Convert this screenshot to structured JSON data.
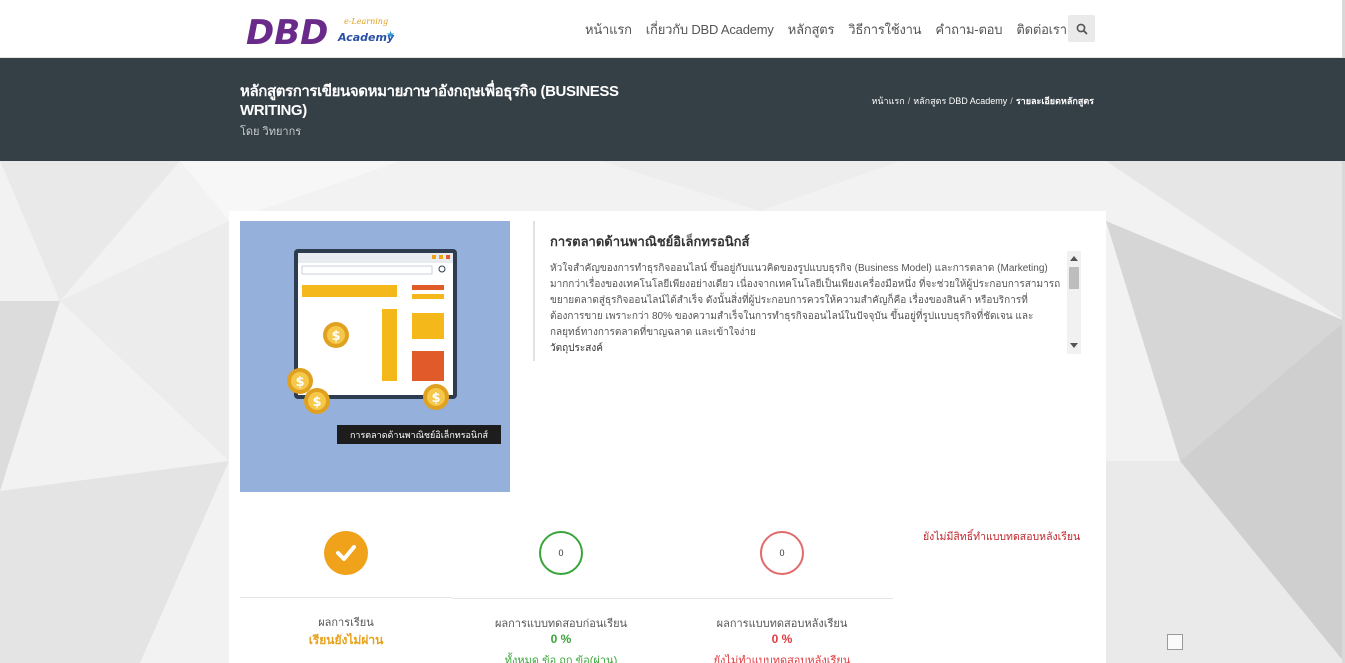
{
  "header": {
    "logo_main": "DBD",
    "logo_sub_top": "e-Learning",
    "logo_sub_bottom": "Academy",
    "nav": [
      "หน้าแรก",
      "เกี่ยวกับ DBD Academy",
      "หลักสูตร",
      "วิธีการใช้งาน",
      "คำถาม-ตอบ",
      "ติดต่อเรา"
    ],
    "search_icon": "search-icon"
  },
  "course": {
    "title": "หลักสูตรการเขียนจดหมายภาษาอังกฤษเพื่อธุรกิจ (BUSINESS WRITING)",
    "by": "โดย วิทยากร",
    "breadcrumb": [
      "หน้าแรก",
      "หลักสูตร DBD Academy",
      "รายละเอียดหลักสูตร"
    ],
    "image_caption": "การตลาดด้านพาณิชย์อิเล็กทรอนิกส์",
    "desc_title": "การตลาดด้านพาณิชย์อิเล็กทรอนิกส์",
    "desc_body": "หัวใจสำคัญของการทำธุรกิจออนไลน์ ขึ้นอยู่กับแนวคิดของรูปแบบธุรกิจ (Business Model) และการตลาด (Marketing) มากกว่าเรื่องของเทคโนโลยีเพียงอย่างเดียว เนื่องจากเทคโนโลยีเป็นเพียงเครื่องมือหนึ่ง ที่จะช่วยให้ผู้ประกอบการสามารถขยายตลาดสู่ธุรกิจออนไลน์ได้สำเร็จ ดังนั้นสิ่งที่ผู้ประกอบการควรให้ความสำคัญก็คือ เรื่องของสินค้า หรือบริการที่ต้องการขาย เพราะกว่า 80% ของความสำเร็จในการทำธุรกิจออนไลน์ในปัจจุบัน ขึ้นอยู่ที่รูปแบบธุรกิจที่ชัดเจน และกลยุทธ์ทางการตลาดที่ขาญฉลาด และเข้าใจง่าย",
    "desc_sub": "วัตถุประสงค์"
  },
  "stats": {
    "learning": {
      "label": "ผลการเรียน",
      "value": "เรียนยังไม่ผ่าน",
      "color": "#e8a21b"
    },
    "pretest": {
      "circle": "0",
      "label": "ผลการแบบทดสอบก่อนเรียน",
      "value": "0 %",
      "sub": "ทั้งหมด ข้อ ถูก ข้อ(ผ่าน)",
      "color": "#3aa53a"
    },
    "posttest": {
      "circle": "0",
      "label": "ผลการแบบทดสอบหลังเรียน",
      "value": "0 %",
      "sub": "ยังไม่ทำแบบทดสอบหลังเรียน",
      "color": "#e0393e"
    },
    "post_note": "ยังไม่มีสิทธิ์ทำแบบทดสอบหลังเรียน"
  }
}
